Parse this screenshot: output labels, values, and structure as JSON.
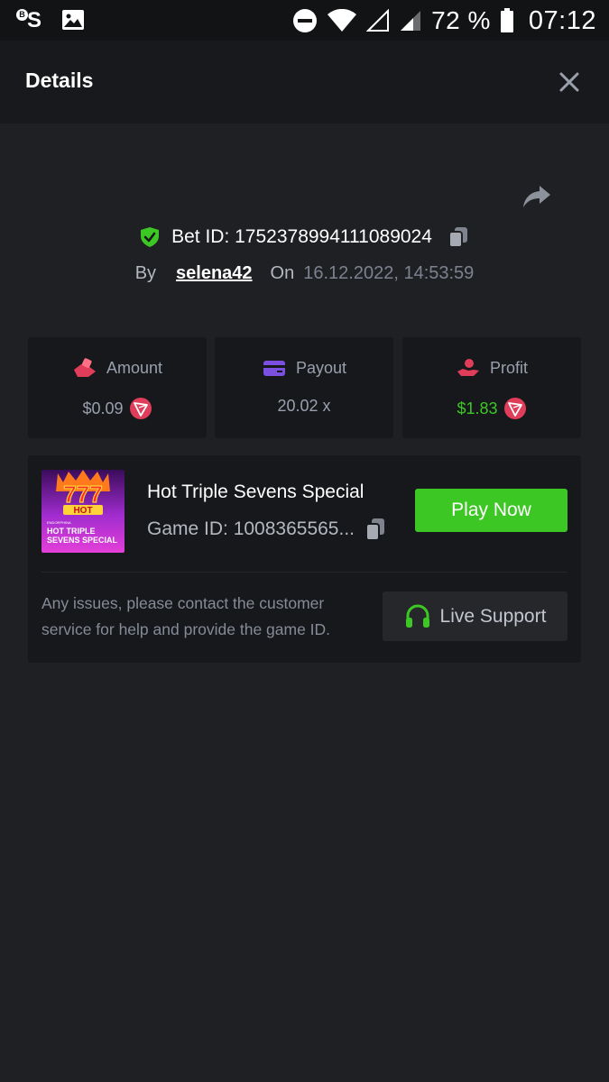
{
  "status_bar": {
    "app_icon_badge": "B",
    "app_icon_letter": "S",
    "battery_percent": "72 %",
    "time": "07:12"
  },
  "header": {
    "title": "Details"
  },
  "bet": {
    "id_text": "Bet ID: 1752378994111089024",
    "by_label": "By",
    "username": "selena42",
    "on_label": "On",
    "date": "16.12.2022, 14:53:59"
  },
  "stats": {
    "amount": {
      "label": "Amount",
      "value": "$0.09"
    },
    "payout": {
      "label": "Payout",
      "value": "20.02 x"
    },
    "profit": {
      "label": "Profit",
      "value": "$1.83"
    }
  },
  "game": {
    "name": "Hot Triple Sevens Special",
    "id_text": "Game ID: 1008365565...",
    "thumb_hot": "HOT",
    "thumb_brand": "ENDORPHINA",
    "thumb_line1": "HOT TRIPLE",
    "thumb_line2": "SEVENS SPECIAL",
    "play_label": "Play Now",
    "support_text": "Any issues, please contact the customer service for help and provide the game ID.",
    "support_label": "Live Support"
  },
  "colors": {
    "background": "#1f2024",
    "card": "#17181b",
    "accent_green": "#3dc724",
    "coin_red": "#e03d5a",
    "payout_purple": "#7b4fe0"
  },
  "icons": {
    "close": "close-icon",
    "share": "share-icon",
    "verified": "shield-check-icon",
    "copy": "copy-icon",
    "amount": "hand-coins-icon",
    "payout": "wallet-icon",
    "profit": "hand-money-icon",
    "coin": "tron-coin-icon",
    "support": "headphones-icon"
  }
}
